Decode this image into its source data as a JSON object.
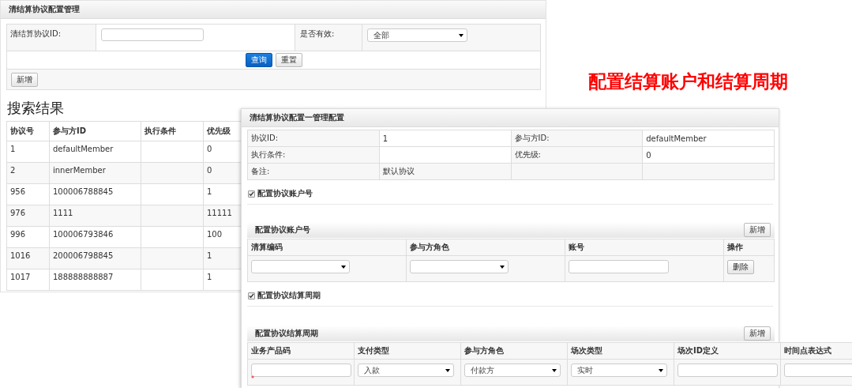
{
  "back_panel": {
    "title": "清结算协议配置管理",
    "search_form": {
      "id_label": "清结算协议ID:",
      "valid_label": "是否有效:",
      "valid_select": "全部",
      "query_button": "查询",
      "reset_button": "重置",
      "add_button": "新增"
    },
    "results": {
      "heading": "搜索结果",
      "columns": [
        "协议号",
        "参与方ID",
        "执行条件",
        "优先级"
      ],
      "rows": [
        {
          "id": "1",
          "member": "defaultMember",
          "priority": "0"
        },
        {
          "id": "2",
          "member": "innerMember",
          "priority": "0"
        },
        {
          "id": "956",
          "member": "100006788845",
          "priority": "1"
        },
        {
          "id": "976",
          "member": "1111",
          "priority": "11111"
        },
        {
          "id": "996",
          "member": "100006793846",
          "priority": "100"
        },
        {
          "id": "1016",
          "member": "200006798845",
          "priority": "1"
        },
        {
          "id": "1017",
          "member": "188888888887",
          "priority": "1"
        }
      ]
    }
  },
  "caption": "配置结算账户和结算周期",
  "detail_panel": {
    "title": "清结算协议配置一管理配置",
    "info_rows": [
      {
        "label_1": "协议ID:",
        "value_1": "1",
        "label_2": "参与方ID:",
        "value_2": "defaultMember"
      },
      {
        "label_1": "执行条件:",
        "label_2": "优先级:",
        "value_2": "0"
      },
      {
        "label_1": "备注:",
        "value_1": "默认协议"
      }
    ],
    "accounts": {
      "toggle": {
        "label": "配置协议账户号",
        "checked": true
      },
      "title": "配置协议账户号",
      "add_button": "新增",
      "columns": [
        "清算编码",
        "参与方角色",
        "账号",
        "操作"
      ],
      "row": [
        {
          "kind": "select"
        },
        {
          "kind": "select"
        },
        {
          "kind": "input"
        },
        {
          "kind": "button",
          "label": "删除"
        }
      ]
    },
    "cycles": {
      "toggle": {
        "label": "配置协议结算周期",
        "checked": true
      },
      "title": "配置协议结算周期",
      "add_button": "新增",
      "columns": [
        "业务产品码",
        "支付类型",
        "参与方角色",
        "场次类型",
        "场次ID定义",
        "时间点表达式"
      ],
      "row": [
        {
          "kind": "input",
          "required_mark": "*"
        },
        {
          "kind": "select",
          "value": "入款"
        },
        {
          "kind": "select",
          "value": "付款方"
        },
        {
          "kind": "select",
          "value": "实时"
        },
        {
          "kind": "input"
        },
        {
          "kind": "input"
        }
      ]
    }
  }
}
